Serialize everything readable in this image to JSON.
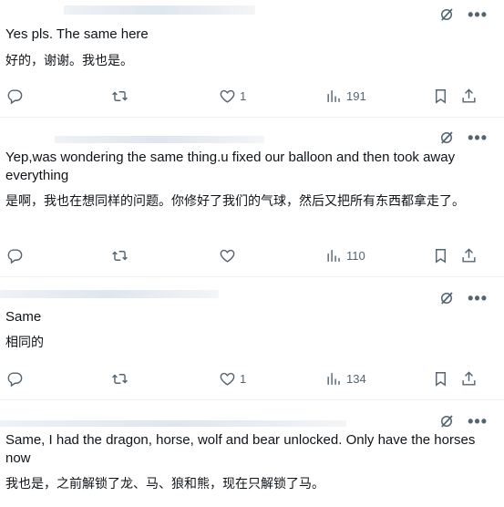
{
  "replies": [
    {
      "text": "Yes pls. The same here",
      "translation": "好的，谢谢。我也是。",
      "likes": "1",
      "views": "191"
    },
    {
      "text": "Yep,was wondering the same thing.u fixed our balloon and then took away everything",
      "translation": "是啊，我也在想同样的问题。你修好了我们的气球，然后又把所有东西都拿走了。",
      "likes": "",
      "views": "110"
    },
    {
      "text": "Same",
      "translation": "相同的",
      "likes": "1",
      "views": "134"
    },
    {
      "text": "Same, I had the dragon, horse, wolf and bear unlocked. Only have the horses now",
      "translation": "我也是，之前解锁了龙、马、狼和熊，现在只解锁了马。"
    }
  ],
  "icons": {
    "reply": "reply-icon",
    "repost": "repost-icon",
    "like": "heart-icon",
    "views": "views-icon",
    "bookmark": "bookmark-icon",
    "share": "share-icon",
    "grok": "grok-icon",
    "more": "more-icon"
  },
  "colors": {
    "text": "#0f1419",
    "secondary": "#536471",
    "divider": "#eff3f4"
  }
}
